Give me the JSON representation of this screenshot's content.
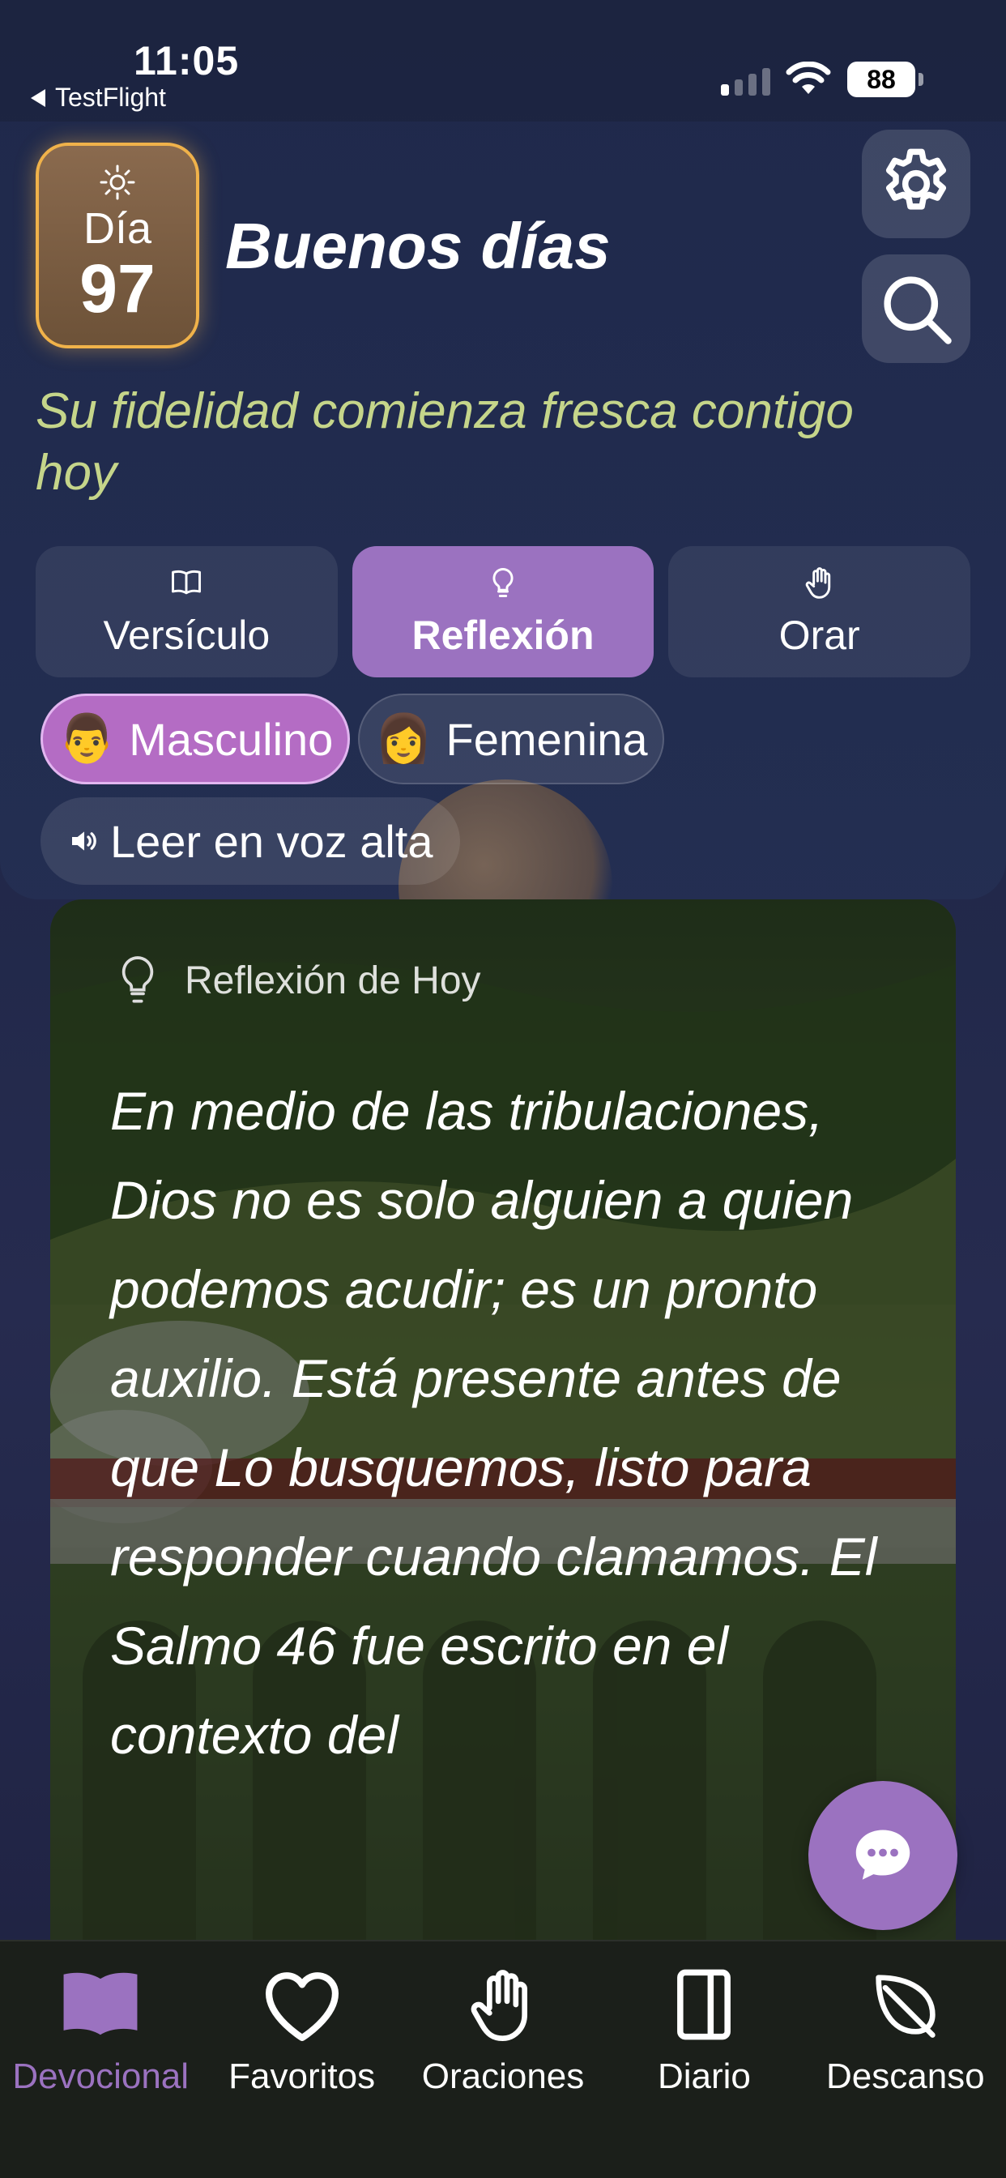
{
  "status_bar": {
    "time": "11:05",
    "back_app": "TestFlight",
    "battery": "88"
  },
  "header": {
    "day_label": "Día",
    "day_number": "97",
    "greeting": "Buenos días",
    "subtitle": "Su fidelidad comienza fresca contigo hoy",
    "settings_icon": "gear-icon",
    "search_icon": "search-icon"
  },
  "tabs": [
    {
      "label": "Versículo",
      "icon": "book-icon",
      "active": false
    },
    {
      "label": "Reflexión",
      "icon": "lightbulb-icon",
      "active": true
    },
    {
      "label": "Orar",
      "icon": "hand-icon",
      "active": false
    }
  ],
  "voice_options": [
    {
      "emoji": "👨",
      "label": "Masculino",
      "active": true
    },
    {
      "emoji": "👩",
      "label": "Femenina",
      "active": false
    }
  ],
  "read_aloud": {
    "label": "Leer en voz alta",
    "icon": "speaker-icon"
  },
  "reflection": {
    "header": "Reflexión de Hoy",
    "text": "En medio de las tribulaciones, Dios no es solo alguien a quien podemos acudir; es un pronto auxilio. Está presente antes de que Lo busquemos, listo para responder cuando clamamos. El Salmo 46 fue escrito en el contexto del"
  },
  "tab_bar": [
    {
      "label": "Devocional",
      "icon": "open-book-icon",
      "active": true
    },
    {
      "label": "Favoritos",
      "icon": "heart-icon",
      "active": false
    },
    {
      "label": "Oraciones",
      "icon": "hand-icon",
      "active": false
    },
    {
      "label": "Diario",
      "icon": "journal-icon",
      "active": false
    },
    {
      "label": "Descanso",
      "icon": "leaf-icon",
      "active": false
    }
  ],
  "colors": {
    "accent": "#9b72c0",
    "badge_border": "#f0b24a",
    "subtitle": "#c5d58a",
    "pill_active": "#b46cc4"
  }
}
